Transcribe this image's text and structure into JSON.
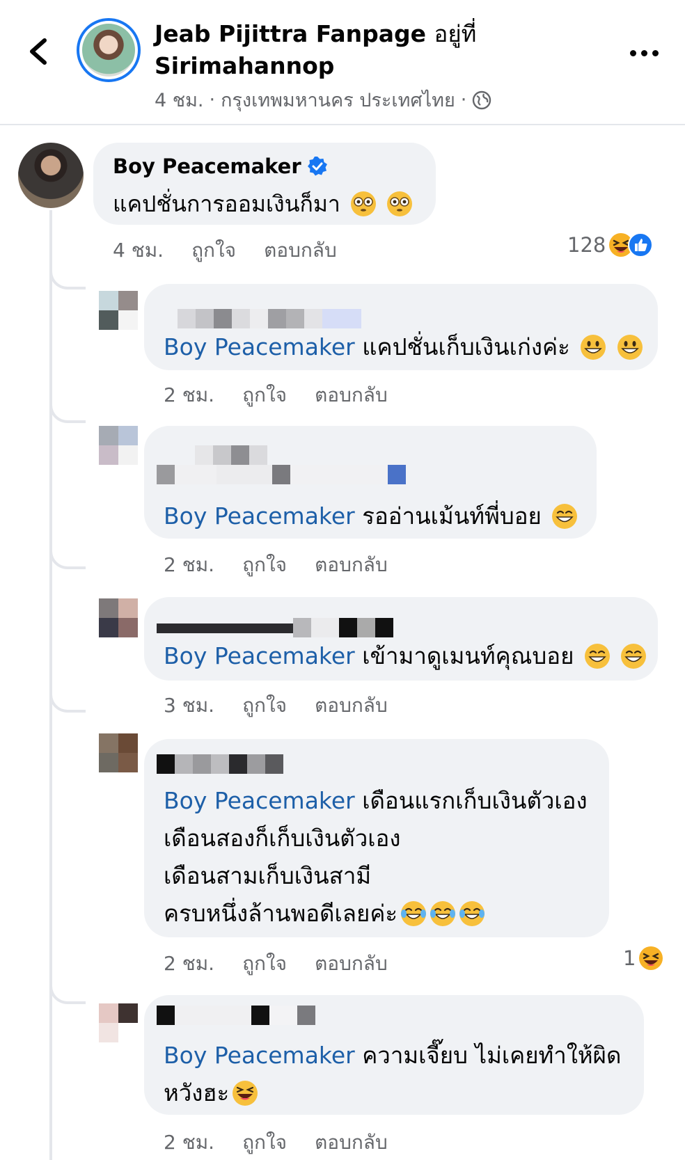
{
  "header": {
    "page_name": "Jeab Pijittra Fanpage",
    "location_prefix": "อยู่ที่",
    "location": "Sirimahannop",
    "time": "4 ชม.",
    "city": "กรุงเทพมหานคร ประเทศไทย",
    "separator": "·"
  },
  "main_comment": {
    "author": "Boy Peacemaker",
    "text": "แคปชั่นการออมเงินก็มา",
    "time": "4 ชม.",
    "like": "ถูกใจ",
    "reply": "ตอบกลับ",
    "reaction_count": "128"
  },
  "replies": [
    {
      "mention": "Boy Peacemaker",
      "text": "แคปชั่นเก็บเงินเก่งค่ะ",
      "time": "2 ชม.",
      "like": "ถูกใจ",
      "reply": "ตอบกลับ"
    },
    {
      "mention": "Boy Peacemaker",
      "text": "รออ่านเม้นท์พี่บอย",
      "time": "2 ชม.",
      "like": "ถูกใจ",
      "reply": "ตอบกลับ"
    },
    {
      "mention": "Boy Peacemaker",
      "text": "เข้ามาดูเมนท์คุณบอย",
      "time": "3 ชม.",
      "like": "ถูกใจ",
      "reply": "ตอบกลับ"
    },
    {
      "mention": "Boy Peacemaker",
      "text": "เดือนแรกเก็บเงินตัวเอง",
      "line2": "เดือนสองก็เก็บเงินตัวเอง",
      "line3": "เดือนสามเก็บเงินสามี",
      "line4": "ครบหนึ่งล้านพอดีเลยค่ะ",
      "time": "2 ชม.",
      "like": "ถูกใจ",
      "reply": "ตอบกลับ",
      "reaction_count": "1"
    },
    {
      "mention": "Boy Peacemaker",
      "text": "ความเจี๊ยบ ไม่เคยทำให้ผิด",
      "line2": "หวังฮะ",
      "time": "2 ชม.",
      "like": "ถูกใจ",
      "reply": "ตอบกลับ"
    }
  ],
  "colors": {
    "mention": "#1d5fa8",
    "bubble": "#f0f2f5",
    "meta": "#65676b",
    "verified": "#1877f2",
    "haha": "#f7b125"
  }
}
